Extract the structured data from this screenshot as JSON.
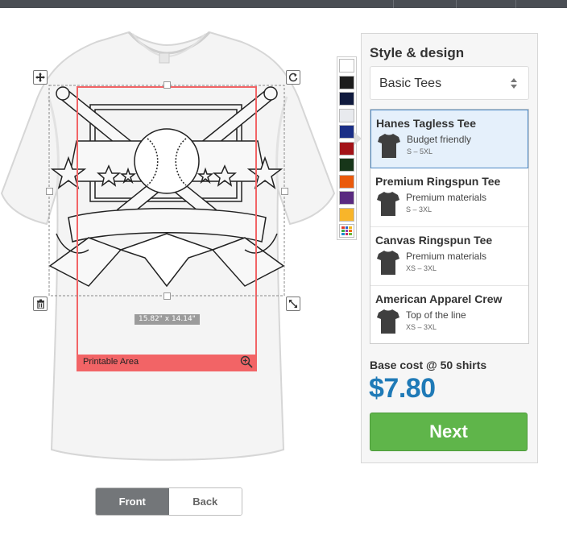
{
  "canvas": {
    "dimension_label": "15.82\" x 14.14\"",
    "printable_label": "Printable Area"
  },
  "swatches": [
    {
      "name": "white",
      "color": "#ffffff"
    },
    {
      "name": "black",
      "color": "#1c1c1c"
    },
    {
      "name": "navy",
      "color": "#101a3e"
    },
    {
      "name": "ash",
      "color": "#e8eaee"
    },
    {
      "name": "royal",
      "color": "#1b2f86"
    },
    {
      "name": "red",
      "color": "#a31217"
    },
    {
      "name": "forest",
      "color": "#173619"
    },
    {
      "name": "orange",
      "color": "#ea5a0c"
    },
    {
      "name": "purple",
      "color": "#5a2a80"
    },
    {
      "name": "gold",
      "color": "#f8b52a"
    },
    {
      "name": "more-colors",
      "color": "multi"
    }
  ],
  "panel": {
    "title": "Style & design",
    "style_select": "Basic Tees",
    "products": [
      {
        "name": "Hanes Tagless Tee",
        "desc": "Budget friendly",
        "sizes": "S – 5XL",
        "selected": true
      },
      {
        "name": "Premium Ringspun Tee",
        "desc": "Premium materials",
        "sizes": "S – 3XL",
        "selected": false
      },
      {
        "name": "Canvas Ringspun Tee",
        "desc": "Premium materials",
        "sizes": "XS – 3XL",
        "selected": false
      },
      {
        "name": "American Apparel Crew",
        "desc": "Top of the line",
        "sizes": "XS – 3XL",
        "selected": false
      }
    ],
    "base_cost_label": "Base cost @ 50 shirts",
    "price": "$7.80",
    "next_label": "Next"
  },
  "toggle": {
    "front": "Front",
    "back": "Back"
  },
  "colors": {
    "accent_blue": "#1f7ab7",
    "next_green": "#5fb54a",
    "printable_red": "#f26466",
    "selected_bg": "#e5f0fb"
  }
}
